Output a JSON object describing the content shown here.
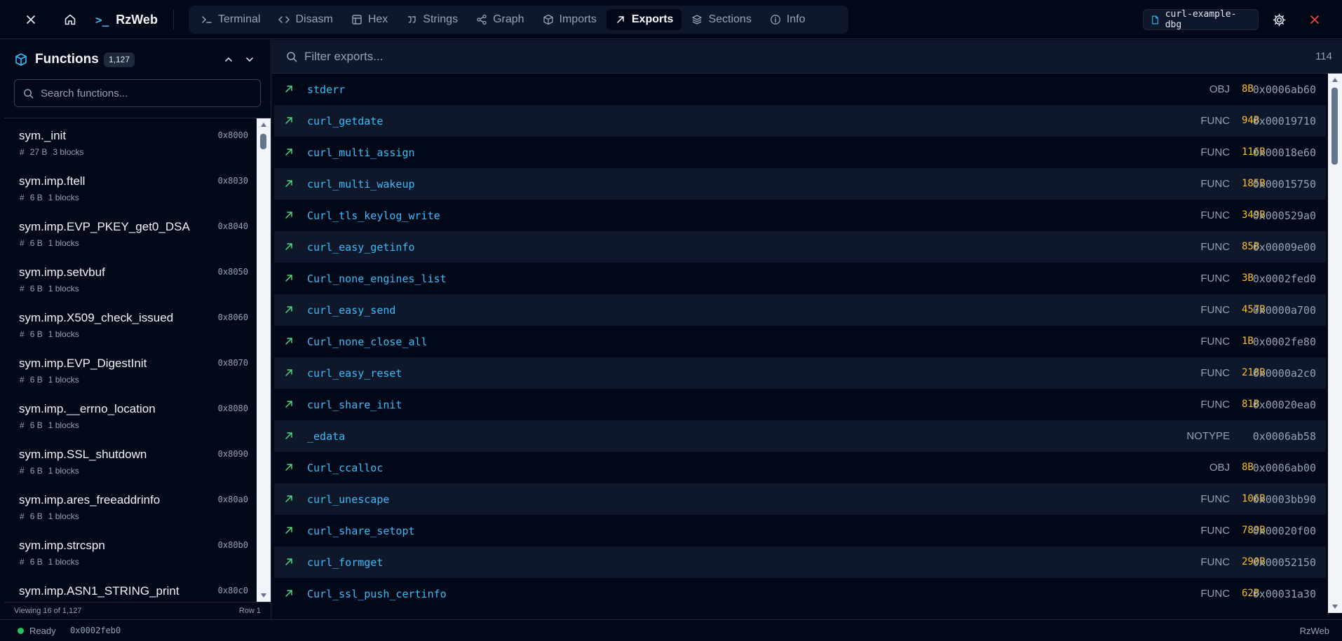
{
  "topbar": {
    "brand": "RzWeb",
    "brand_prompt": ">_",
    "tabs": [
      {
        "label": "Terminal",
        "icon": "terminal-icon"
      },
      {
        "label": "Disasm",
        "icon": "code-icon"
      },
      {
        "label": "Hex",
        "icon": "table-icon"
      },
      {
        "label": "Strings",
        "icon": "quote-icon"
      },
      {
        "label": "Graph",
        "icon": "share-icon"
      },
      {
        "label": "Imports",
        "icon": "package-icon"
      },
      {
        "label": "Exports",
        "icon": "arrow-up-right-icon",
        "active": true
      },
      {
        "label": "Sections",
        "icon": "layers-icon"
      },
      {
        "label": "Info",
        "icon": "info-icon"
      }
    ],
    "file_name": "curl-example-dbg"
  },
  "functions_panel": {
    "title": "Functions",
    "count": "1,127",
    "search_placeholder": "Search functions...",
    "items": [
      {
        "name": "sym._init",
        "addr": "0x8000",
        "size": "27 B",
        "blocks": "3 blocks"
      },
      {
        "name": "sym.imp.ftell",
        "addr": "0x8030",
        "size": "6 B",
        "blocks": "1 blocks"
      },
      {
        "name": "sym.imp.EVP_PKEY_get0_DSA",
        "addr": "0x8040",
        "size": "6 B",
        "blocks": "1 blocks"
      },
      {
        "name": "sym.imp.setvbuf",
        "addr": "0x8050",
        "size": "6 B",
        "blocks": "1 blocks"
      },
      {
        "name": "sym.imp.X509_check_issued",
        "addr": "0x8060",
        "size": "6 B",
        "blocks": "1 blocks"
      },
      {
        "name": "sym.imp.EVP_DigestInit",
        "addr": "0x8070",
        "size": "6 B",
        "blocks": "1 blocks"
      },
      {
        "name": "sym.imp.__errno_location",
        "addr": "0x8080",
        "size": "6 B",
        "blocks": "1 blocks"
      },
      {
        "name": "sym.imp.SSL_shutdown",
        "addr": "0x8090",
        "size": "6 B",
        "blocks": "1 blocks"
      },
      {
        "name": "sym.imp.ares_freeaddrinfo",
        "addr": "0x80a0",
        "size": "6 B",
        "blocks": "1 blocks"
      },
      {
        "name": "sym.imp.strcspn",
        "addr": "0x80b0",
        "size": "6 B",
        "blocks": "1 blocks"
      },
      {
        "name": "sym.imp.ASN1_STRING_print",
        "addr": "0x80c0",
        "size": "",
        "blocks": ""
      }
    ],
    "footer_left": "Viewing 16 of 1,127",
    "footer_right": "Row 1"
  },
  "exports_panel": {
    "filter_placeholder": "Filter exports...",
    "count": "114",
    "rows": [
      {
        "name": "stderr",
        "type": "OBJ",
        "size": "8B",
        "addr": "0x0006ab60"
      },
      {
        "name": "curl_getdate",
        "type": "FUNC",
        "size": "94B",
        "addr": "0x00019710"
      },
      {
        "name": "curl_multi_assign",
        "type": "FUNC",
        "size": "116B",
        "addr": "0x00018e60"
      },
      {
        "name": "curl_multi_wakeup",
        "type": "FUNC",
        "size": "185B",
        "addr": "0x00015750"
      },
      {
        "name": "Curl_tls_keylog_write",
        "type": "FUNC",
        "size": "349B",
        "addr": "0x000529a0"
      },
      {
        "name": "curl_easy_getinfo",
        "type": "FUNC",
        "size": "85B",
        "addr": "0x00009e00"
      },
      {
        "name": "Curl_none_engines_list",
        "type": "FUNC",
        "size": "3B",
        "addr": "0x0002fed0"
      },
      {
        "name": "curl_easy_send",
        "type": "FUNC",
        "size": "457B",
        "addr": "0x0000a700"
      },
      {
        "name": "Curl_none_close_all",
        "type": "FUNC",
        "size": "1B",
        "addr": "0x0002fe80"
      },
      {
        "name": "curl_easy_reset",
        "type": "FUNC",
        "size": "218B",
        "addr": "0x0000a2c0"
      },
      {
        "name": "curl_share_init",
        "type": "FUNC",
        "size": "81B",
        "addr": "0x00020ea0"
      },
      {
        "name": "_edata",
        "type": "NOTYPE",
        "size": "",
        "addr": "0x0006ab58"
      },
      {
        "name": "Curl_ccalloc",
        "type": "OBJ",
        "size": "8B",
        "addr": "0x0006ab00"
      },
      {
        "name": "curl_unescape",
        "type": "FUNC",
        "size": "106B",
        "addr": "0x0003bb90"
      },
      {
        "name": "curl_share_setopt",
        "type": "FUNC",
        "size": "789B",
        "addr": "0x00020f00"
      },
      {
        "name": "curl_formget",
        "type": "FUNC",
        "size": "290B",
        "addr": "0x00052150"
      },
      {
        "name": "Curl_ssl_push_certinfo",
        "type": "FUNC",
        "size": "62B",
        "addr": "0x00031a30"
      }
    ]
  },
  "statusbar": {
    "status": "Ready",
    "address": "0x0002feb0",
    "app": "RzWeb"
  },
  "colors": {
    "background": "#020817",
    "panel": "#0f172a",
    "accent": "#38bdf8",
    "size": "#fbbf24",
    "export_arrow": "#4ade80",
    "close": "#ef4444"
  }
}
